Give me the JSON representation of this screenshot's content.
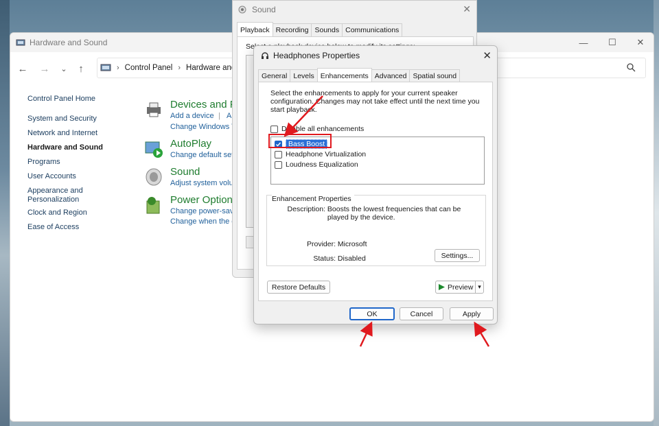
{
  "control_panel": {
    "title": "Hardware and Sound",
    "address": [
      "Control Panel",
      "Hardware and S"
    ],
    "sidebar": [
      {
        "label": "Control Panel Home",
        "bold": false
      },
      {
        "label": "System and Security",
        "bold": false
      },
      {
        "label": "Network and Internet",
        "bold": false
      },
      {
        "label": "Hardware and Sound",
        "bold": true
      },
      {
        "label": "Programs",
        "bold": false
      },
      {
        "label": "User Accounts",
        "bold": false
      },
      {
        "label": "Appearance and Personalization",
        "bold": false
      },
      {
        "label": "Clock and Region",
        "bold": false
      },
      {
        "label": "Ease of Access",
        "bold": false
      }
    ],
    "categories": [
      {
        "title": "Devices and Pr",
        "links": [
          "Add a device",
          "A",
          "Change Windows T"
        ]
      },
      {
        "title": "AutoPlay",
        "links": [
          "Change default set"
        ]
      },
      {
        "title": "Sound",
        "links": [
          "Adjust system volu"
        ]
      },
      {
        "title": "Power Options",
        "links": [
          "Change power-sav",
          "Change when the c"
        ]
      }
    ]
  },
  "sound_dialog": {
    "title": "Sound",
    "tabs": [
      "Playback",
      "Recording",
      "Sounds",
      "Communications"
    ],
    "active_tab": "Playback",
    "instruction": "Select a playback device below to modify its settings:"
  },
  "headphones_dialog": {
    "title": "Headphones Properties",
    "tabs": [
      "General",
      "Levels",
      "Enhancements",
      "Advanced",
      "Spatial sound"
    ],
    "active_tab": "Enhancements",
    "intro": "Select the enhancements to apply for your current speaker configuration. Changes may not take effect until the next time you start playback.",
    "disable_all_label": "Disable all enhancements",
    "disable_all_checked": false,
    "enhancements": [
      {
        "label": "Bass Boost",
        "checked": true
      },
      {
        "label": "Headphone Virtualization",
        "checked": false
      },
      {
        "label": "Loudness Equalization",
        "checked": false
      }
    ],
    "properties": {
      "group_title": "Enhancement Properties",
      "description_label": "Description:",
      "description": "Boosts the lowest frequencies that can be played by the device.",
      "provider_label": "Provider:",
      "provider": "Microsoft",
      "status_label": "Status:",
      "status": "Disabled",
      "settings_button": "Settings..."
    },
    "restore_defaults": "Restore Defaults",
    "preview": "Preview",
    "ok": "OK",
    "cancel": "Cancel",
    "apply": "Apply"
  },
  "colors": {
    "annotation_red": "#e0191e",
    "link_blue": "#1f5f9a",
    "category_green": "#1e7c2e",
    "focus_blue": "#1f66c9"
  }
}
